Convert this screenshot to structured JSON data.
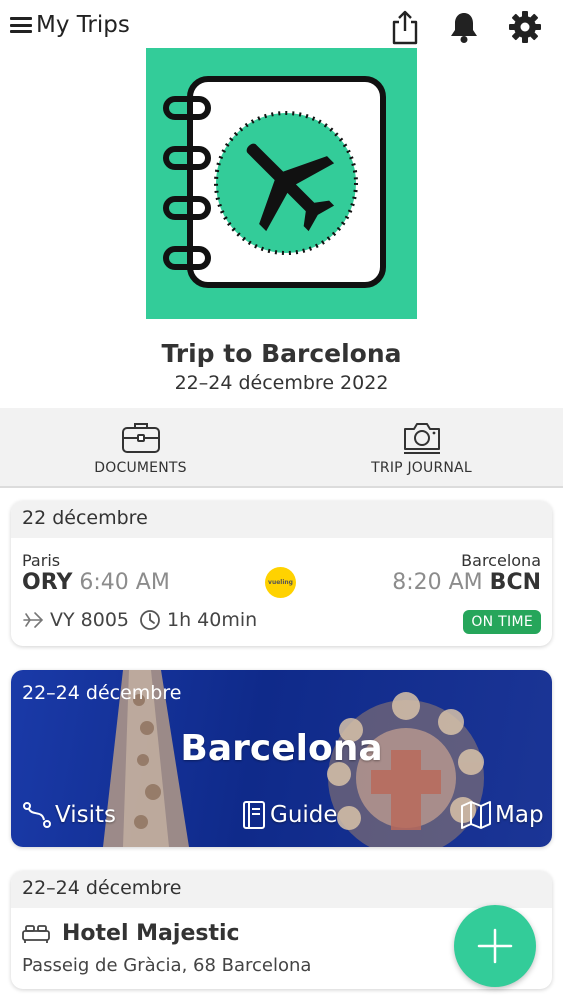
{
  "header": {
    "title": "My Trips"
  },
  "trip": {
    "title": "Trip to Barcelona",
    "dates": "22–24 décembre 2022"
  },
  "tabs": [
    {
      "label": "DOCUMENTS",
      "icon": "briefcase-icon"
    },
    {
      "label": "TRIP JOURNAL",
      "icon": "camera-icon"
    }
  ],
  "flight": {
    "date": "22 décembre",
    "from_city": "Paris",
    "from_code": "ORY",
    "dep_time": "6:40 AM",
    "to_city": "Barcelona",
    "to_code": "BCN",
    "arr_time": "8:20 AM",
    "airline_logo": "vueling",
    "flight_number": "VY 8005",
    "duration": "1h 40min",
    "status": "ON TIME"
  },
  "destination": {
    "dates": "22–24 décembre",
    "name": "Barcelona",
    "links": {
      "visits": "Visits",
      "guide": "Guide",
      "map": "Map"
    }
  },
  "hotel": {
    "dates": "22–24 décembre",
    "name": "Hotel Majestic",
    "address": "Passeig de Gràcia, 68 Barcelona"
  },
  "colors": {
    "accent": "#33cc99",
    "status_green": "#26a65b",
    "dest_blue": "#13308f",
    "airline_yellow": "#ffd200"
  }
}
